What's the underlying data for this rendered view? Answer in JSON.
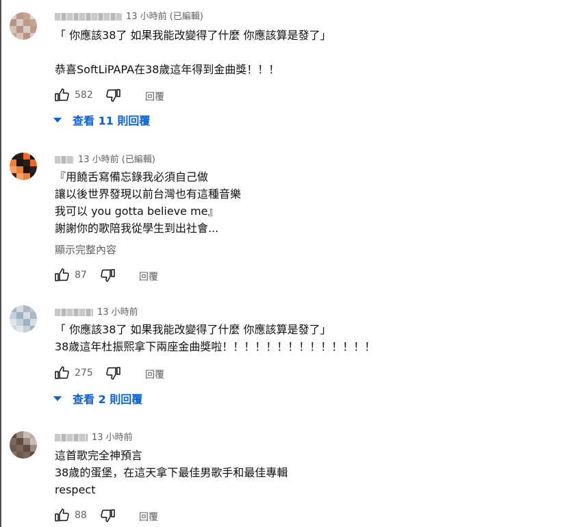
{
  "comments": [
    {
      "time": "13 小時前 (已編輯)",
      "lines": [
        "「 你應該38了  如果我能改變得了什麼  你應該算是發了」",
        "恭喜SoftLiPAPA在38歲這年得到金曲獎！！！"
      ],
      "likes": "582",
      "reply_label": "回覆",
      "view_replies": "查看 11 則回覆",
      "avatar_colors": [
        "#d9ccc4",
        "#c8a592",
        "#c4a596",
        "#b89384",
        "#a87f6d",
        "#c09a87",
        "#d6c3b8",
        "#e4d8d0"
      ]
    },
    {
      "time": "13 小時前 (已編輯)",
      "lines": [
        "『用饒舌寫備忘錄我必須自己做",
        "讓以後世界發現以前台灣也有這種音樂",
        "我可以 you gotta believe me』",
        "謝謝你的歌陪我從學生到出社會..."
      ],
      "show_more": "顯示完整內容",
      "likes": "87",
      "reply_label": "回覆",
      "avatar_colors": [
        "#0a0a0a",
        "#1e140f",
        "#3b2416",
        "#f06a1d",
        "#ef7f33",
        "#c0612a",
        "#26201c",
        "#f2a16b"
      ]
    },
    {
      "time": "13 小時前",
      "lines": [
        "「 你應該38了  如果我能改變得了什麼  你應該算是發了」",
        "38歲這年杜振熙拿下兩座金曲獎啦！！！！！！！！！！！！！！"
      ],
      "likes": "275",
      "reply_label": "回覆",
      "view_replies": "查看 2 則回覆",
      "avatar_colors": [
        "#e2e6ea",
        "#b9c8d6",
        "#9fb2c4",
        "#d0d7de",
        "#a9b9c7",
        "#c7d1da",
        "#eef0f2",
        "#d8dde2"
      ]
    },
    {
      "time": "13 小時前",
      "lines": [
        "這首歌完全神預言",
        "38歲的蛋堡，在這天拿下最佳男歌手和最佳專輯",
        "respect"
      ],
      "likes": "88",
      "reply_label": "回覆",
      "avatar_colors": [
        "#9a8a80",
        "#6f5a4f",
        "#b9aca4",
        "#5d4a40",
        "#8a776c",
        "#c8bdb6",
        "#7a665b",
        "#a49287"
      ]
    }
  ]
}
